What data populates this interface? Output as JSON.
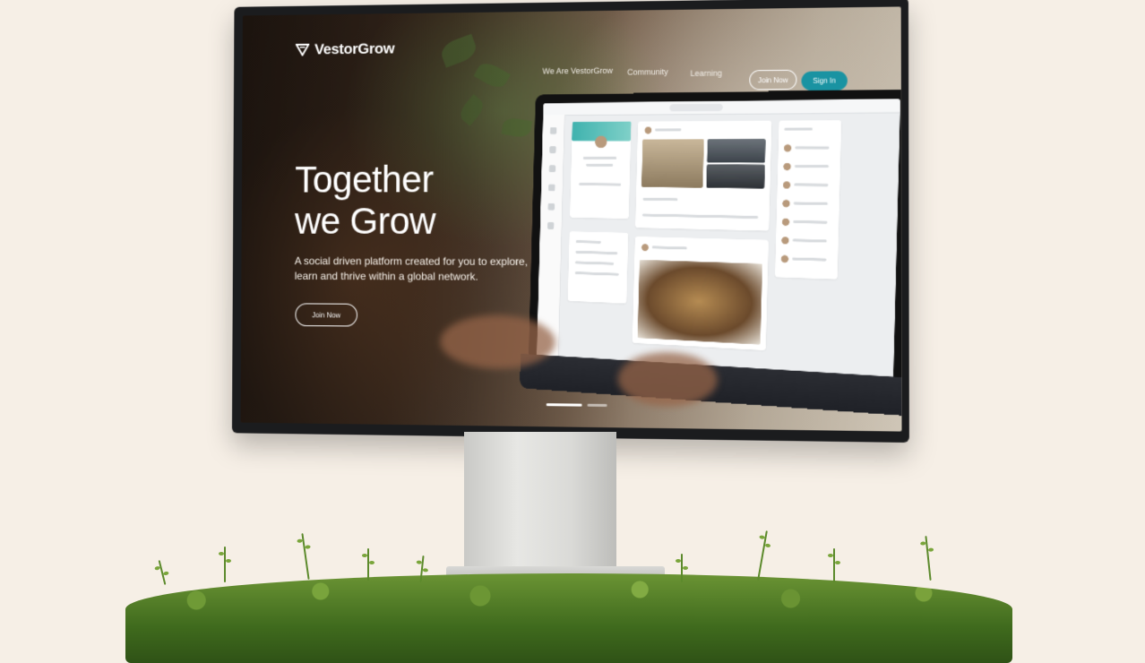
{
  "site": {
    "logo_text": "VestorGrow",
    "nav": {
      "links": [
        "We Are VestorGrow",
        "Community",
        "Learning"
      ],
      "join_label": "Join Now",
      "signin_label": "Sign In"
    },
    "hero": {
      "title": "Together\nwe Grow",
      "subtitle": "A social driven platform created for you to explore, learn and thrive within a global network.",
      "cta_label": "Join Now"
    },
    "carousel": {
      "slides": 2,
      "active_index": 0
    }
  },
  "colors": {
    "accent": "#1a93a2",
    "background": "#f6efe6",
    "hedge": "#5f8c2e"
  },
  "icons": [
    "vestorgrow-logo-icon"
  ]
}
